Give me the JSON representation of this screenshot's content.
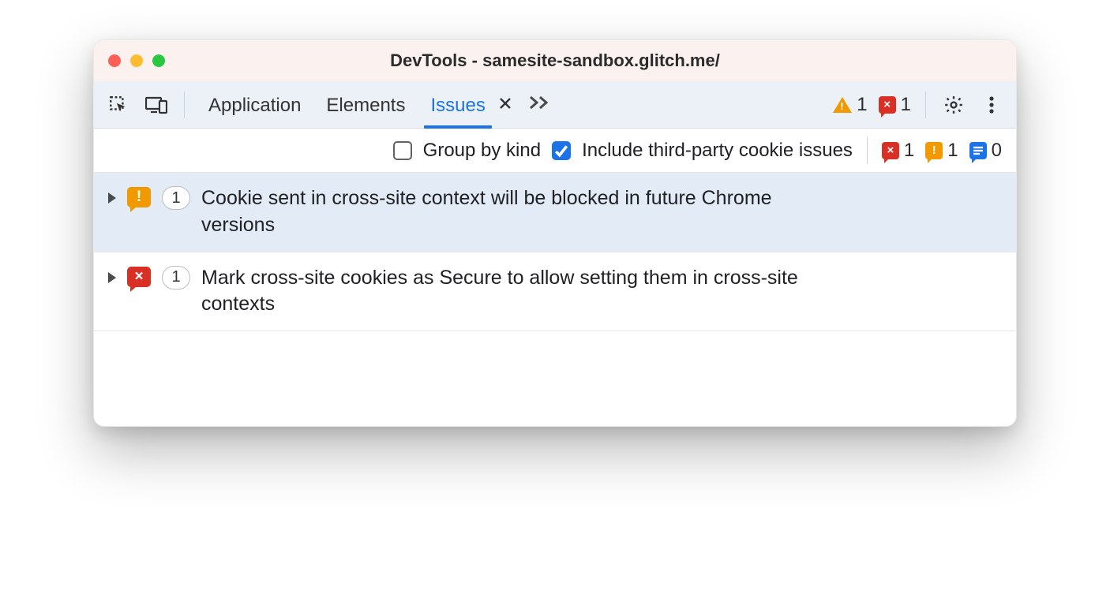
{
  "window": {
    "title": "DevTools - samesite-sandbox.glitch.me/"
  },
  "tabs": {
    "items": [
      "Application",
      "Elements",
      "Issues"
    ],
    "active_index": 2
  },
  "toolbar_counts": {
    "warning": "1",
    "error": "1"
  },
  "filterbar": {
    "group_by_kind_label": "Group by kind",
    "group_by_kind_checked": false,
    "include_third_party_label": "Include third-party cookie issues",
    "include_third_party_checked": true,
    "counts": {
      "error": "1",
      "warning": "1",
      "info": "0"
    }
  },
  "issues": [
    {
      "severity": "warning",
      "count": "1",
      "title": "Cookie sent in cross-site context will be blocked in future Chrome versions",
      "selected": true
    },
    {
      "severity": "error",
      "count": "1",
      "title": "Mark cross-site cookies as Secure to allow setting them in cross-site contexts",
      "selected": false
    }
  ]
}
